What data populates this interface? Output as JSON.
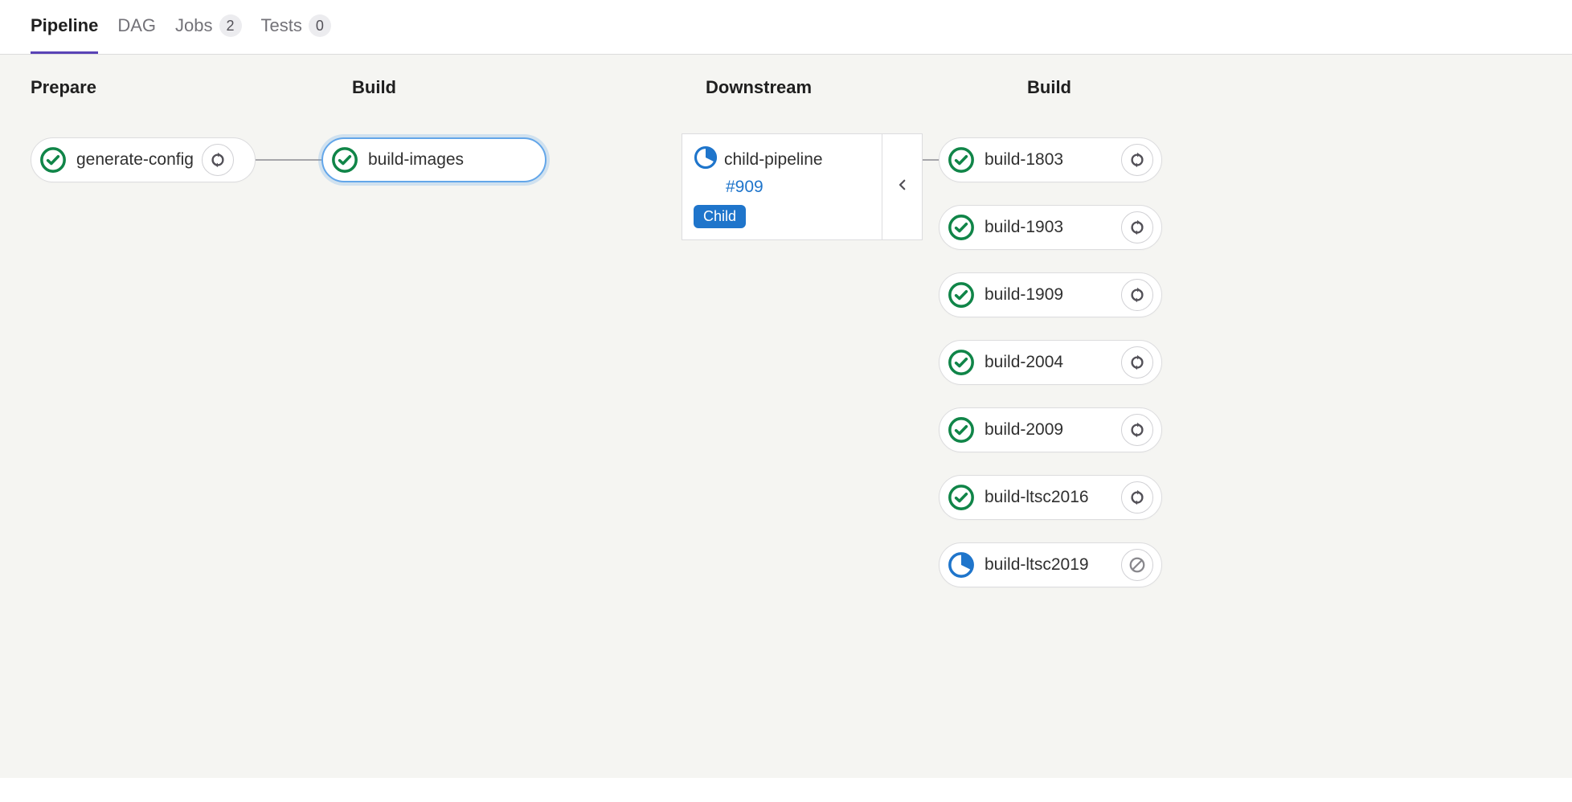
{
  "tabs": {
    "pipeline": "Pipeline",
    "dag": "DAG",
    "jobs_label": "Jobs",
    "jobs_count": "2",
    "tests_label": "Tests",
    "tests_count": "0"
  },
  "stages": {
    "prepare": "Prepare",
    "build1": "Build",
    "downstream": "Downstream",
    "build2": "Build"
  },
  "jobs": {
    "generate_config": "generate-config",
    "build_images": "build-images",
    "build_1803": "build-1803",
    "build_1903": "build-1903",
    "build_1909": "build-1909",
    "build_2004": "build-2004",
    "build_2009": "build-2009",
    "build_ltsc2016": "build-ltsc2016",
    "build_ltsc2019": "build-ltsc2019"
  },
  "downstream_card": {
    "title": "child-pipeline",
    "id": "#909",
    "badge": "Child"
  },
  "colors": {
    "success": "#108548",
    "running": "#1f75cb",
    "muted": "#737278"
  }
}
